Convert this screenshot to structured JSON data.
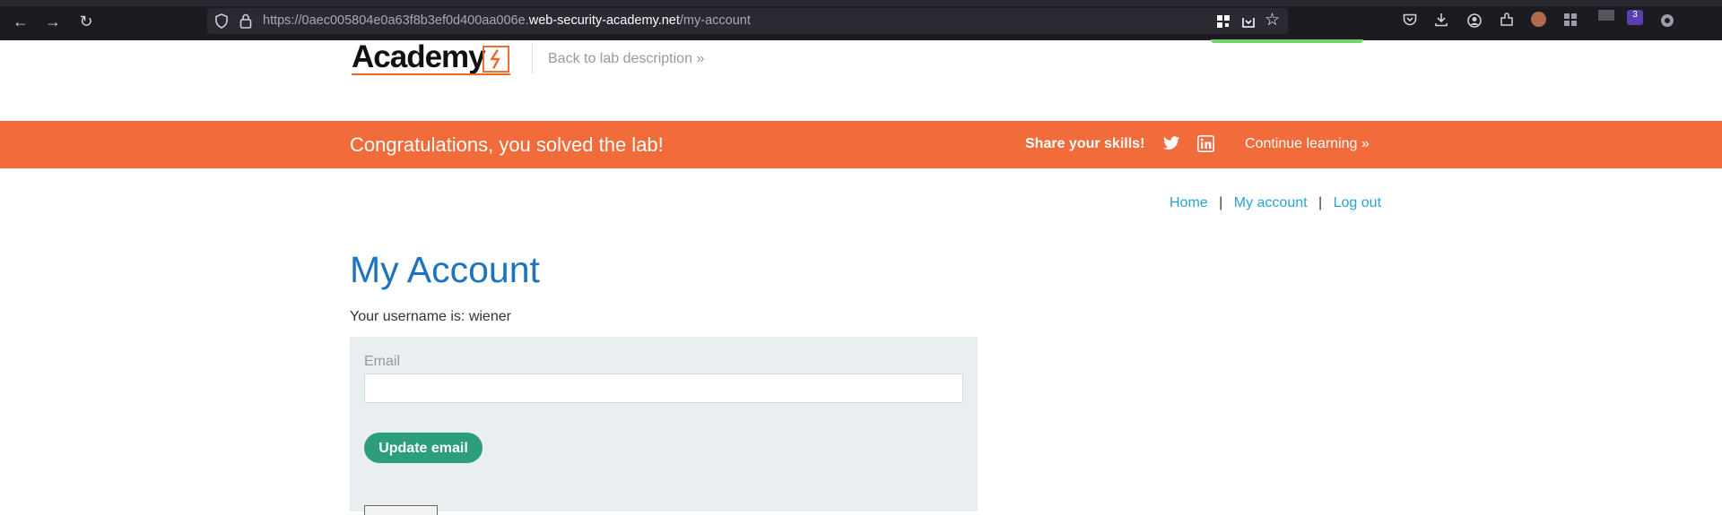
{
  "browser": {
    "url_prefix": "https://0aec005804e0a63f8b3ef0d400aa006e.",
    "url_domain": "web-security-academy.net",
    "url_path": "/my-account",
    "profile_badge": "3"
  },
  "header": {
    "logo_text": "Academy",
    "back_link": "Back to lab description",
    "back_chevron": "»"
  },
  "banner": {
    "message": "Congratulations, you solved the lab!",
    "share_label": "Share your skills!",
    "continue_label": "Continue learning",
    "continue_chevron": "»",
    "color": "#f26b3a"
  },
  "nav": {
    "home": "Home",
    "sep1": "|",
    "my_account": "My account",
    "sep2": "|",
    "log_out": "Log out"
  },
  "main": {
    "title": "My Account",
    "username_line": "Your username is: wiener",
    "email_label": "Email",
    "email_value": "",
    "update_button": "Update email"
  },
  "colors": {
    "accent_orange": "#f26522",
    "title_blue": "#1e73be",
    "link_blue": "#29a3d6",
    "button_green": "#2c9e7b"
  }
}
